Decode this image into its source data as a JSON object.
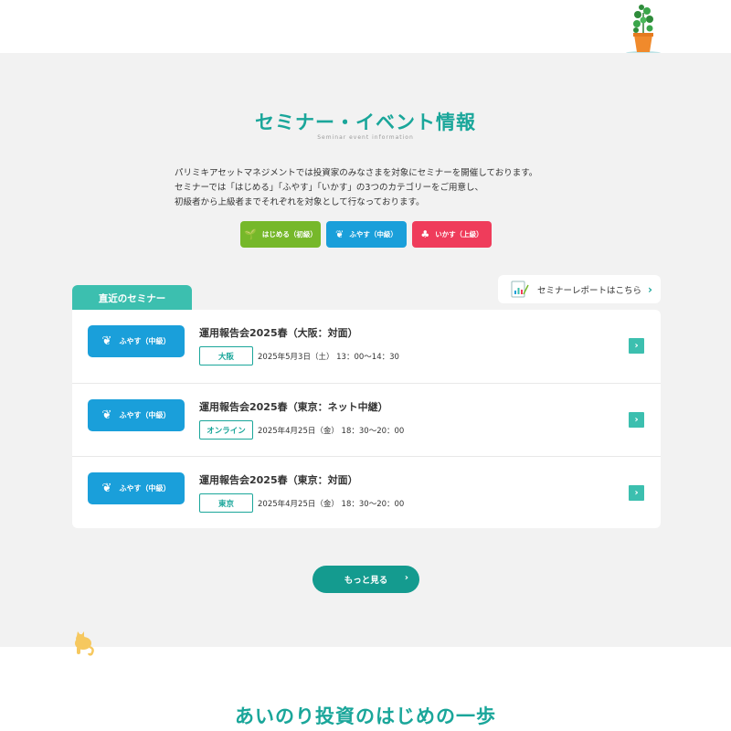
{
  "header": {
    "plant_icon": "potted-plant-icon"
  },
  "seminar": {
    "title": "セミナー・イベント情報",
    "subtitle": "Seminar event information",
    "intro": [
      "パリミキアセットマネジメントでは投資家のみなさまを対象にセミナーを開催しております。",
      "セミナーでは「はじめる」「ふやす」「いかす」の3つのカテゴリーをご用意し、",
      "初級者から上級者までそれぞれを対象として行なっております。"
    ],
    "categories": [
      {
        "label": "はじめる（初級）",
        "icon": "sprout-icon",
        "color": "#76b82a"
      },
      {
        "label": "ふやす（中級）",
        "icon": "leaf-tree-icon",
        "color": "#1a9fda"
      },
      {
        "label": "いかす（上級）",
        "icon": "tree-icon",
        "color": "#ef3c5b"
      }
    ],
    "recent_tab": "直近のセミナー",
    "report_link": "セミナーレポートはこちら",
    "events": [
      {
        "category": "ふやす（中級）",
        "title": "運用報告会2025春（大阪：対面）",
        "location": "大阪",
        "datetime": "2025年5月3日（土） 13：00〜14：30"
      },
      {
        "category": "ふやす（中級）",
        "title": "運用報告会2025春（東京：ネット中継）",
        "location": "オンライン",
        "datetime": "2025年4月25日（金） 18：30〜20：00"
      },
      {
        "category": "ふやす（中級）",
        "title": "運用報告会2025春（東京：対面）",
        "location": "東京",
        "datetime": "2025年4月25日（金） 18：30〜20：00"
      }
    ],
    "more_button": "もっと見る"
  },
  "next_section": {
    "title": "あいのり投資のはじめの一歩"
  },
  "colors": {
    "accent": "#1aa69a",
    "tab": "#3cbfaf",
    "more_button": "#149b8f",
    "background_gray": "#f2f2f2"
  }
}
